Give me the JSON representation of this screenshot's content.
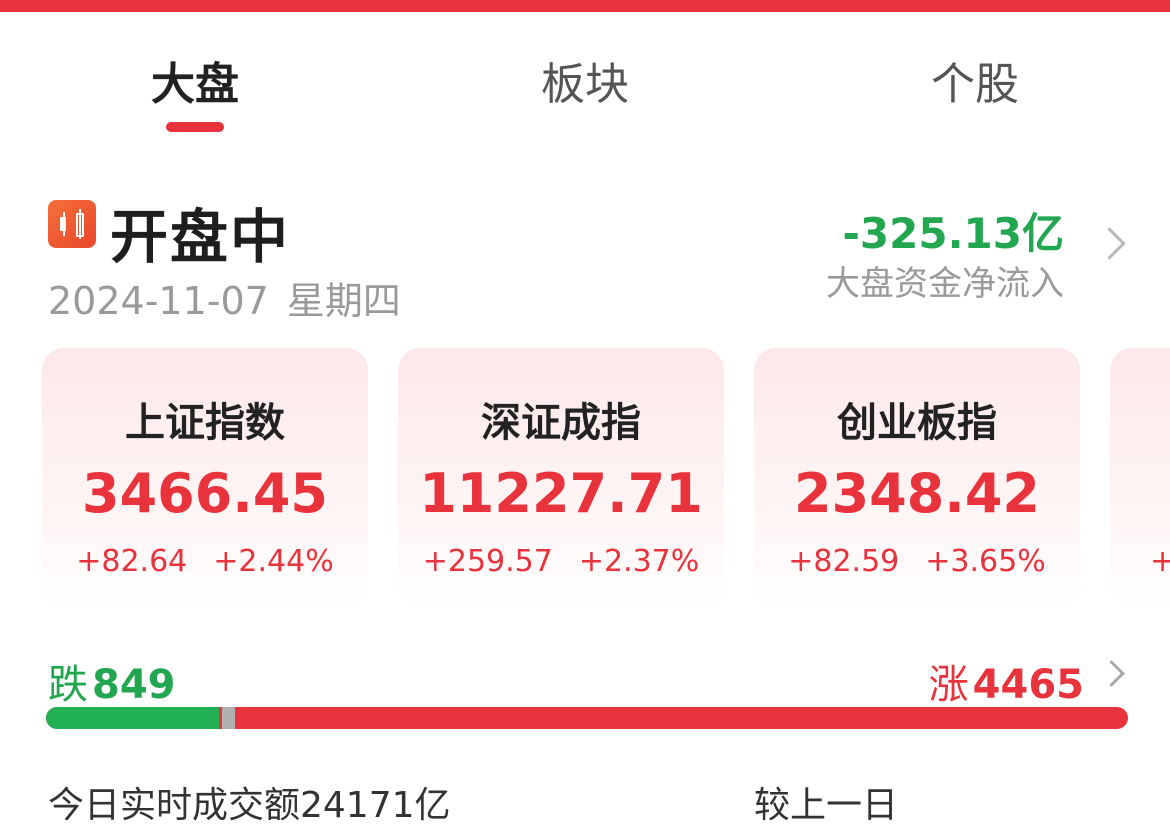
{
  "tabs": [
    {
      "label": "大盘",
      "active": true
    },
    {
      "label": "板块",
      "active": false
    },
    {
      "label": "个股",
      "active": false
    }
  ],
  "status": {
    "icon": "candlestick-icon",
    "title": "开盘中",
    "date": "2024-11-07",
    "weekday": "星期四"
  },
  "net_flow": {
    "value": "-325.13亿",
    "label": "大盘资金净流入"
  },
  "indices": [
    {
      "name": "上证指数",
      "price": "3466.45",
      "change": "+82.64",
      "pct": "+2.44%"
    },
    {
      "name": "深证成指",
      "price": "11227.71",
      "change": "+259.57",
      "pct": "+2.37%"
    },
    {
      "name": "创业板指",
      "price": "2348.42",
      "change": "+82.59",
      "pct": "+3.65%"
    },
    {
      "name": "",
      "price": "",
      "change": "+",
      "pct": ""
    }
  ],
  "breadth": {
    "fall_label": "跌",
    "fall_count": 849,
    "rise_label": "涨",
    "rise_count": 4465,
    "fall_fraction": 0.16,
    "flat_fraction": 0.012
  },
  "turnover": {
    "text": "今日实时成交额24171亿"
  },
  "compare": {
    "text": "较上一日"
  },
  "colors": {
    "accent_red": "#e8323c",
    "fall_green": "#22a650",
    "card_bg": "#fde8ea"
  }
}
